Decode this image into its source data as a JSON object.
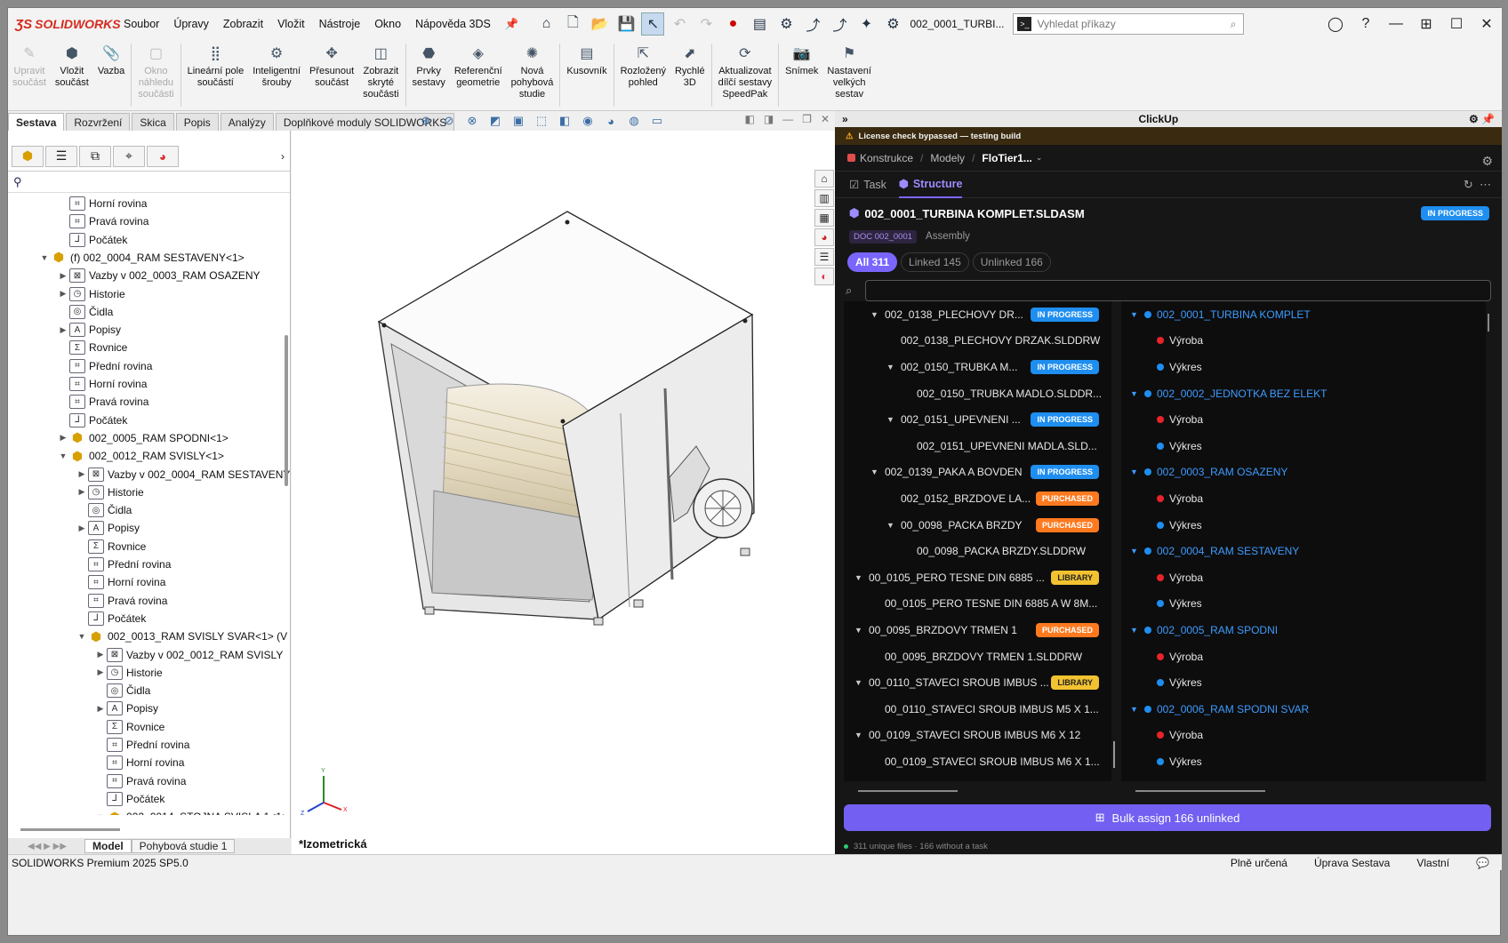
{
  "app": {
    "logo": "SOLIDWORKS",
    "doc_title": "002_0001_TURBI...",
    "search_placeholder": "Vyhledat příkazy"
  },
  "menu": [
    "Soubor",
    "Úpravy",
    "Zobrazit",
    "Vložit",
    "Nástroje",
    "Okno",
    "Nápověda 3DS"
  ],
  "ribbon": [
    {
      "label": "Upravit\nsoučást",
      "disabled": true,
      "icon": "edit-part-icon"
    },
    {
      "label": "Vložit\nsoučást",
      "icon": "insert-component-icon"
    },
    {
      "label": "Vazba",
      "icon": "mate-icon"
    },
    {
      "label": "Okno\nnáhledu\nsoučásti",
      "disabled": true,
      "icon": "preview-window-icon"
    },
    {
      "label": "Lineární pole\nsoučástí",
      "icon": "linear-pattern-icon"
    },
    {
      "label": "Inteligentní\nšrouby",
      "icon": "smart-fasteners-icon"
    },
    {
      "label": "Přesunout\nsoučást",
      "icon": "move-component-icon"
    },
    {
      "label": "Zobrazit\nskryté\nsoučásti",
      "icon": "show-hidden-icon"
    },
    {
      "label": "Prvky\nsestavy",
      "icon": "assembly-features-icon"
    },
    {
      "label": "Referenční\ngeometrie",
      "icon": "reference-geometry-icon"
    },
    {
      "label": "Nová\npohybová\nstudie",
      "icon": "motion-study-icon"
    },
    {
      "label": "Kusovník",
      "icon": "bom-icon"
    },
    {
      "label": "Rozložený\npohled",
      "icon": "exploded-view-icon"
    },
    {
      "label": "Rychlé\n3D",
      "icon": "instant3d-icon"
    },
    {
      "label": "Aktualizovat\ndílčí sestavy\nSpeedPak",
      "icon": "speedpak-icon"
    },
    {
      "label": "Snímek",
      "icon": "snapshot-icon"
    },
    {
      "label": "Nastavení\nvelkých\nsestav",
      "icon": "large-assembly-icon"
    }
  ],
  "tabs": [
    "Sestava",
    "Rozvržení",
    "Skica",
    "Popis",
    "Analýzy",
    "Doplňkové moduly SOLIDWORKS"
  ],
  "tree": [
    {
      "d": 3,
      "t": "Horní rovina",
      "i": "plane"
    },
    {
      "d": 3,
      "t": "Pravá rovina",
      "i": "plane"
    },
    {
      "d": 3,
      "t": "Počátek",
      "i": "origin"
    },
    {
      "d": 2,
      "t": "(f) 002_0004_RAM SESTAVENY<1>",
      "i": "asm",
      "a": "▼"
    },
    {
      "d": 3,
      "t": "Vazby v 002_0003_RAM OSAZENY",
      "i": "mates",
      "a": "▶"
    },
    {
      "d": 3,
      "t": "Historie",
      "i": "hist",
      "a": "▶"
    },
    {
      "d": 3,
      "t": "Čidla",
      "i": "sens"
    },
    {
      "d": 3,
      "t": "Popisy",
      "i": "ann",
      "a": "▶"
    },
    {
      "d": 3,
      "t": "Rovnice",
      "i": "eq"
    },
    {
      "d": 3,
      "t": "Přední rovina",
      "i": "plane"
    },
    {
      "d": 3,
      "t": "Horní rovina",
      "i": "plane"
    },
    {
      "d": 3,
      "t": "Pravá rovina",
      "i": "plane"
    },
    {
      "d": 3,
      "t": "Počátek",
      "i": "origin"
    },
    {
      "d": 3,
      "t": "002_0005_RAM SPODNI<1>",
      "i": "asm",
      "a": "▶"
    },
    {
      "d": 3,
      "t": "002_0012_RAM SVISLY<1>",
      "i": "asm",
      "a": "▼"
    },
    {
      "d": 4,
      "t": "Vazby v 002_0004_RAM SESTAVENY",
      "i": "mates",
      "a": "▶"
    },
    {
      "d": 4,
      "t": "Historie",
      "i": "hist",
      "a": "▶"
    },
    {
      "d": 4,
      "t": "Čidla",
      "i": "sens"
    },
    {
      "d": 4,
      "t": "Popisy",
      "i": "ann",
      "a": "▶"
    },
    {
      "d": 4,
      "t": "Rovnice",
      "i": "eq"
    },
    {
      "d": 4,
      "t": "Přední rovina",
      "i": "plane"
    },
    {
      "d": 4,
      "t": "Horní rovina",
      "i": "plane"
    },
    {
      "d": 4,
      "t": "Pravá rovina",
      "i": "plane"
    },
    {
      "d": 4,
      "t": "Počátek",
      "i": "origin"
    },
    {
      "d": 4,
      "t": "002_0013_RAM SVISLY SVAR<1> (V",
      "i": "asm",
      "a": "▼"
    },
    {
      "d": 5,
      "t": "Vazby v 002_0012_RAM SVISLY",
      "i": "mates",
      "a": "▶"
    },
    {
      "d": 5,
      "t": "Historie",
      "i": "hist",
      "a": "▶"
    },
    {
      "d": 5,
      "t": "Čidla",
      "i": "sens"
    },
    {
      "d": 5,
      "t": "Popisy",
      "i": "ann",
      "a": "▶"
    },
    {
      "d": 5,
      "t": "Rovnice",
      "i": "eq"
    },
    {
      "d": 5,
      "t": "Přední rovina",
      "i": "plane"
    },
    {
      "d": 5,
      "t": "Horní rovina",
      "i": "plane"
    },
    {
      "d": 5,
      "t": "Pravá rovina",
      "i": "plane"
    },
    {
      "d": 5,
      "t": "Počátek",
      "i": "origin"
    },
    {
      "d": 5,
      "t": "002_0014_STOJNA SVISLA 1<1:",
      "i": "asm",
      "a": "▼"
    }
  ],
  "bottom_tabs": [
    "Model",
    "Pohybová studie 1"
  ],
  "view_label": "*Izometrická",
  "plugin": {
    "title": "ClickUp",
    "warning": "License check bypassed — testing build",
    "breadcrumb": [
      "Konstrukce",
      "Modely",
      "FloTier1..."
    ],
    "tabs": [
      "Task",
      "Structure"
    ],
    "doc_name": "002_0001_TURBINA KOMPLET.SLDASM",
    "doc_status": "IN PROGRESS",
    "doc_code": "DOC 002_0001",
    "doc_type": "Assembly",
    "filters": [
      "All 311",
      "Linked 145",
      "Unlinked 166"
    ],
    "left_list": [
      {
        "d": 0,
        "t": "002_0138_PLECHOVY DR...",
        "c": "▼",
        "b": "IN PROGRESS",
        "k": "prog"
      },
      {
        "d": 1,
        "t": "002_0138_PLECHOVY DRZAK.SLDDRW"
      },
      {
        "d": 1,
        "t": "002_0150_TRUBKA M...",
        "c": "▼",
        "b": "IN PROGRESS",
        "k": "prog"
      },
      {
        "d": 2,
        "t": "002_0150_TRUBKA MADLO.SLDDR..."
      },
      {
        "d": 1,
        "t": "002_0151_UPEVNENI ...",
        "c": "▼",
        "b": "IN PROGRESS",
        "k": "prog"
      },
      {
        "d": 2,
        "t": "002_0151_UPEVNENI MADLA.SLD..."
      },
      {
        "d": 0,
        "t": "002_0139_PAKA A BOVDEN",
        "c": "▼",
        "b": "IN PROGRESS",
        "k": "prog"
      },
      {
        "d": 1,
        "t": "002_0152_BRZDOVE LA...",
        "b": "PURCHASED",
        "k": "purch"
      },
      {
        "d": 1,
        "t": "00_0098_PACKA BRZDY",
        "c": "▼",
        "b": "PURCHASED",
        "k": "purch"
      },
      {
        "d": 2,
        "t": "00_0098_PACKA BRZDY.SLDDRW"
      },
      {
        "d": -1,
        "t": "00_0105_PERO TESNE DIN 6885 ...",
        "c": "▼",
        "b": "LIBRARY",
        "k": "lib"
      },
      {
        "d": 0,
        "t": "00_0105_PERO TESNE DIN 6885 A W 8M..."
      },
      {
        "d": -1,
        "t": "00_0095_BRZDOVY TRMEN 1",
        "c": "▼",
        "b": "PURCHASED",
        "k": "purch"
      },
      {
        "d": 0,
        "t": "00_0095_BRZDOVY TRMEN 1.SLDDRW"
      },
      {
        "d": -1,
        "t": "00_0110_STAVECI SROUB IMBUS ...",
        "c": "▼",
        "b": "LIBRARY",
        "k": "lib"
      },
      {
        "d": 0,
        "t": "00_0110_STAVECI SROUB IMBUS M5 X 1..."
      },
      {
        "d": -1,
        "t": "00_0109_STAVECI SROUB IMBUS M6 X 12",
        "c": "▼"
      },
      {
        "d": 0,
        "t": "00_0109_STAVECI SROUB IMBUS M6 X 1..."
      }
    ],
    "right_list": [
      {
        "t": "002_0001_TURBINA KOMPLET",
        "link": true
      },
      {
        "t": "Výroba",
        "dot": "red"
      },
      {
        "t": "Výkres",
        "dot": "blue"
      },
      {
        "t": "002_0002_JEDNOTKA BEZ ELEKT",
        "link": true
      },
      {
        "t": "Výroba",
        "dot": "red"
      },
      {
        "t": "Výkres",
        "dot": "blue"
      },
      {
        "t": "002_0003_RAM OSAZENY",
        "link": true
      },
      {
        "t": "Výroba",
        "dot": "red"
      },
      {
        "t": "Výkres",
        "dot": "blue"
      },
      {
        "t": "002_0004_RAM SESTAVENY",
        "link": true
      },
      {
        "t": "Výroba",
        "dot": "red"
      },
      {
        "t": "Výkres",
        "dot": "blue"
      },
      {
        "t": "002_0005_RAM SPODNI",
        "link": true
      },
      {
        "t": "Výroba",
        "dot": "red"
      },
      {
        "t": "Výkres",
        "dot": "blue"
      },
      {
        "t": "002_0006_RAM SPODNI SVAR",
        "link": true
      },
      {
        "t": "Výroba",
        "dot": "red"
      },
      {
        "t": "Výkres",
        "dot": "blue"
      }
    ],
    "bulk_label": "Bulk assign 166 unlinked",
    "footer": "311 unique files · 166 without a task"
  },
  "status": {
    "left": "SOLIDWORKS Premium 2025 SP5.0",
    "items": [
      "Plně určená",
      "Úprava Sestava",
      "Vlastní"
    ]
  },
  "colors": {
    "accent": "#7a66ff",
    "in_progress": "#1e8ef0",
    "purchased": "#ff7a1f",
    "library": "#f2c230",
    "brand": "#d52b1e"
  }
}
